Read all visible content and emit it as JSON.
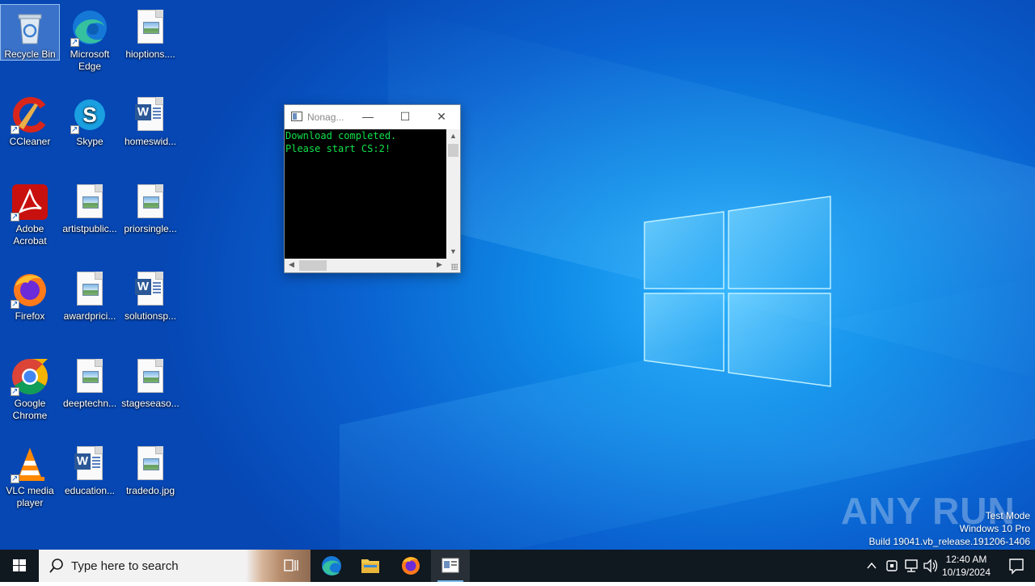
{
  "desktop": {
    "icons": [
      {
        "label": "Recycle Bin"
      },
      {
        "label": "Microsoft Edge"
      },
      {
        "label": "hioptions...."
      },
      {
        "label": "CCleaner"
      },
      {
        "label": "Skype"
      },
      {
        "label": "homeswid..."
      },
      {
        "label": "Adobe Acrobat"
      },
      {
        "label": "artistpublic..."
      },
      {
        "label": "priorsingle..."
      },
      {
        "label": "Firefox"
      },
      {
        "label": "awardprici..."
      },
      {
        "label": "solutionsp..."
      },
      {
        "label": "Google Chrome"
      },
      {
        "label": "deeptechn..."
      },
      {
        "label": "stageseaso..."
      },
      {
        "label": "VLC media player"
      },
      {
        "label": "education..."
      },
      {
        "label": "tradedo.jpg"
      }
    ]
  },
  "console": {
    "title": "Nonag...",
    "lines": [
      "Download completed.",
      "",
      "Please start CS:2!"
    ]
  },
  "watermark": {
    "brand": "ANY RUN",
    "line1": "Test Mode",
    "line2": "Windows 10 Pro",
    "line3": "Build 19041.vb_release.191206-1406"
  },
  "taskbar": {
    "search_placeholder": "Type here to search",
    "time": "12:40 AM",
    "date": "10/19/2024"
  },
  "colors": {
    "console_text": "#10e24a",
    "taskbar": "#101820",
    "wallpaper_accent": "#2fb2ff"
  }
}
